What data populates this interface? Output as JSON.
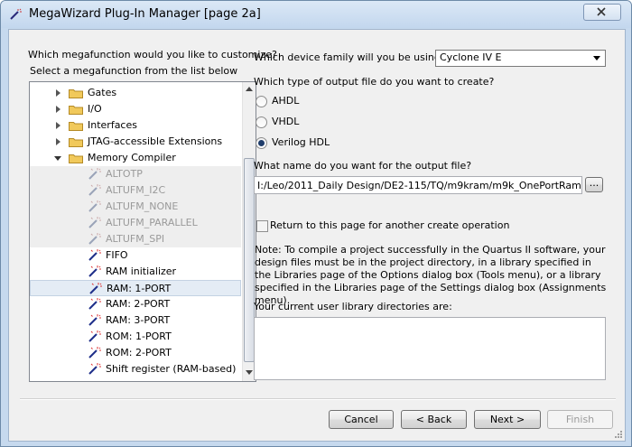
{
  "window": {
    "title": "MegaWizard Plug-In Manager [page 2a]",
    "close_icon": "close-icon"
  },
  "left": {
    "question": "Which megafunction would you like to customize?",
    "select_prompt": "Select a megafunction from the list below",
    "tree": [
      {
        "label": "Gates",
        "kind": "folder",
        "state": "collapsed",
        "level": 0
      },
      {
        "label": "I/O",
        "kind": "folder",
        "state": "collapsed",
        "level": 0
      },
      {
        "label": "Interfaces",
        "kind": "folder",
        "state": "collapsed",
        "level": 0
      },
      {
        "label": "JTAG-accessible Extensions",
        "kind": "folder",
        "state": "collapsed",
        "level": 0
      },
      {
        "label": "Memory Compiler",
        "kind": "folder",
        "state": "expanded",
        "level": 0
      },
      {
        "label": "ALTOTP",
        "kind": "wand",
        "disabled": true,
        "level": 1
      },
      {
        "label": "ALTUFM_I2C",
        "kind": "wand",
        "disabled": true,
        "level": 1
      },
      {
        "label": "ALTUFM_NONE",
        "kind": "wand",
        "disabled": true,
        "level": 1
      },
      {
        "label": "ALTUFM_PARALLEL",
        "kind": "wand",
        "disabled": true,
        "level": 1
      },
      {
        "label": "ALTUFM_SPI",
        "kind": "wand",
        "disabled": true,
        "level": 1
      },
      {
        "label": "FIFO",
        "kind": "wand",
        "level": 1
      },
      {
        "label": "RAM initializer",
        "kind": "wand",
        "level": 1
      },
      {
        "label": "RAM: 1-PORT",
        "kind": "wand",
        "selected": true,
        "level": 1
      },
      {
        "label": "RAM: 2-PORT",
        "kind": "wand",
        "level": 1
      },
      {
        "label": "RAM: 3-PORT",
        "kind": "wand",
        "level": 1
      },
      {
        "label": "ROM: 1-PORT",
        "kind": "wand",
        "level": 1
      },
      {
        "label": "ROM: 2-PORT",
        "kind": "wand",
        "level": 1
      },
      {
        "label": "Shift register (RAM-based)",
        "kind": "wand",
        "level": 1
      }
    ]
  },
  "right": {
    "device_question": "Which device family will you be using?",
    "device_value": "Cyclone IV E",
    "output_question": "Which type of output file do you want to create?",
    "output_options": [
      {
        "label": "AHDL",
        "checked": false
      },
      {
        "label": "VHDL",
        "checked": false
      },
      {
        "label": "Verilog HDL",
        "checked": true
      }
    ],
    "filename_question": "What name do you want for the output file?",
    "filename_value": "I:/Leo/2011_Daily Design/DE2-115/TQ/m9kram/m9k_OnePortRam",
    "browse_label": "...",
    "return_label": "Return to this page for another create operation",
    "note": "Note: To compile a project successfully in the Quartus II software, your design files must be in the project directory, in a library specified in the Libraries page of the Options dialog box (Tools menu), or a library specified in the Libraries page of the Settings dialog box (Assignments menu).",
    "library_label": "Your current user library directories are:",
    "library_value": ""
  },
  "buttons": {
    "cancel": "Cancel",
    "back": "< Back",
    "next": "Next >",
    "finish": "Finish"
  },
  "colors": {
    "frame": "#c6d9ee",
    "dialog": "#f0f0f0",
    "folder": "#f1c95b",
    "selection": "#e4ecf5"
  }
}
